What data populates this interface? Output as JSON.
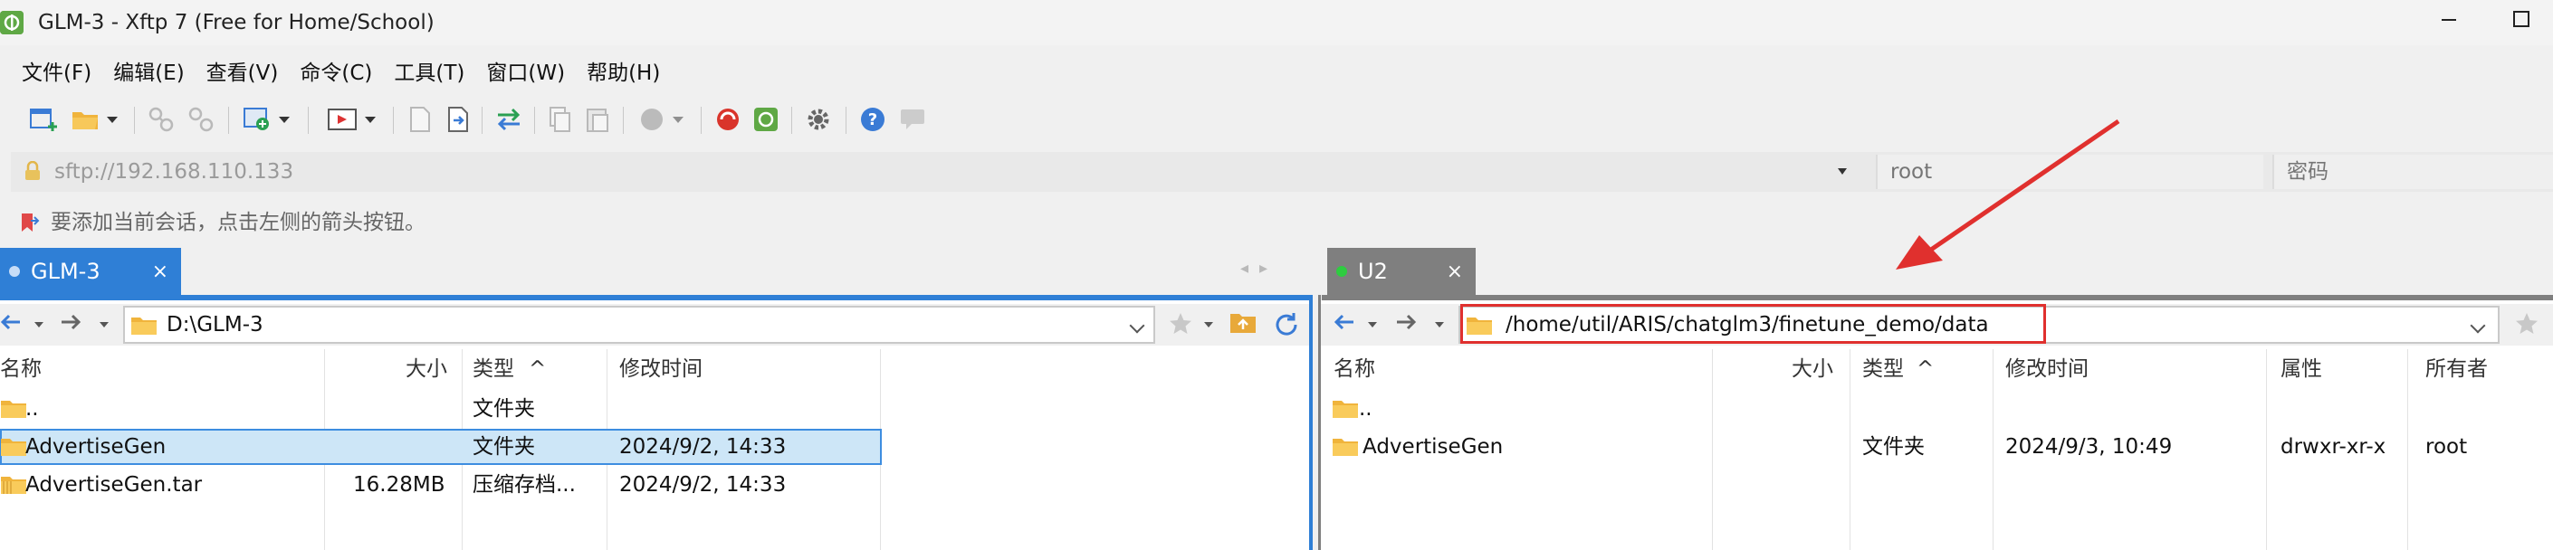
{
  "window": {
    "title": "GLM-3 - Xftp 7 (Free for Home/School)",
    "logo_letter": "⌀"
  },
  "menu": [
    "文件(F)",
    "编辑(E)",
    "查看(V)",
    "命令(C)",
    "工具(T)",
    "窗口(W)",
    "帮助(H)"
  ],
  "address": {
    "url": "sftp://192.168.110.133",
    "user_placeholder": "root",
    "password_placeholder": "密码"
  },
  "hint": "要添加当前会话，点击左侧的箭头按钮。",
  "tabs": {
    "left": {
      "label": "GLM-3",
      "close": "×",
      "dot_color": "#c7ddf7"
    },
    "right": {
      "label": "U2",
      "close": "×",
      "dot_color": "#2ecc40"
    }
  },
  "left_pane": {
    "path": "D:\\GLM-3",
    "columns": {
      "name": "名称",
      "size": "大小",
      "type": "类型",
      "modified": "修改时间"
    },
    "rows": [
      {
        "name": "..",
        "size": "",
        "type": "文件夹",
        "modified": ""
      },
      {
        "name": "AdvertiseGen",
        "size": "",
        "type": "文件夹",
        "modified": "2024/9/2, 14:33"
      },
      {
        "name": "AdvertiseGen.tar",
        "size": "16.28MB",
        "type": "压缩存档...",
        "modified": "2024/9/2, 14:33"
      }
    ],
    "selected_row": 1
  },
  "right_pane": {
    "path": "/home/util/ARIS/chatglm3/finetune_demo/data",
    "columns": {
      "name": "名称",
      "size": "大小",
      "type": "类型",
      "modified": "修改时间",
      "attrs": "属性",
      "owner": "所有者"
    },
    "rows": [
      {
        "name": "..",
        "size": "",
        "type": "",
        "modified": "",
        "attrs": "",
        "owner": ""
      },
      {
        "name": "AdvertiseGen",
        "size": "",
        "type": "文件夹",
        "modified": "2024/9/3, 10:49",
        "attrs": "drwxr-xr-x",
        "owner": "root"
      }
    ]
  },
  "colors": {
    "accent_blue": "#2f7fd6",
    "inactive_tab": "#7f7f7f",
    "selection": "#cde6f7",
    "annotation_red": "#e0302e"
  },
  "glyphs": {
    "minimize": "☐",
    "maximize": "☐",
    "tab_prev": "◂",
    "tab_next": "▸",
    "sort_up": "^",
    "back": "🡐",
    "forward": "🡒"
  }
}
